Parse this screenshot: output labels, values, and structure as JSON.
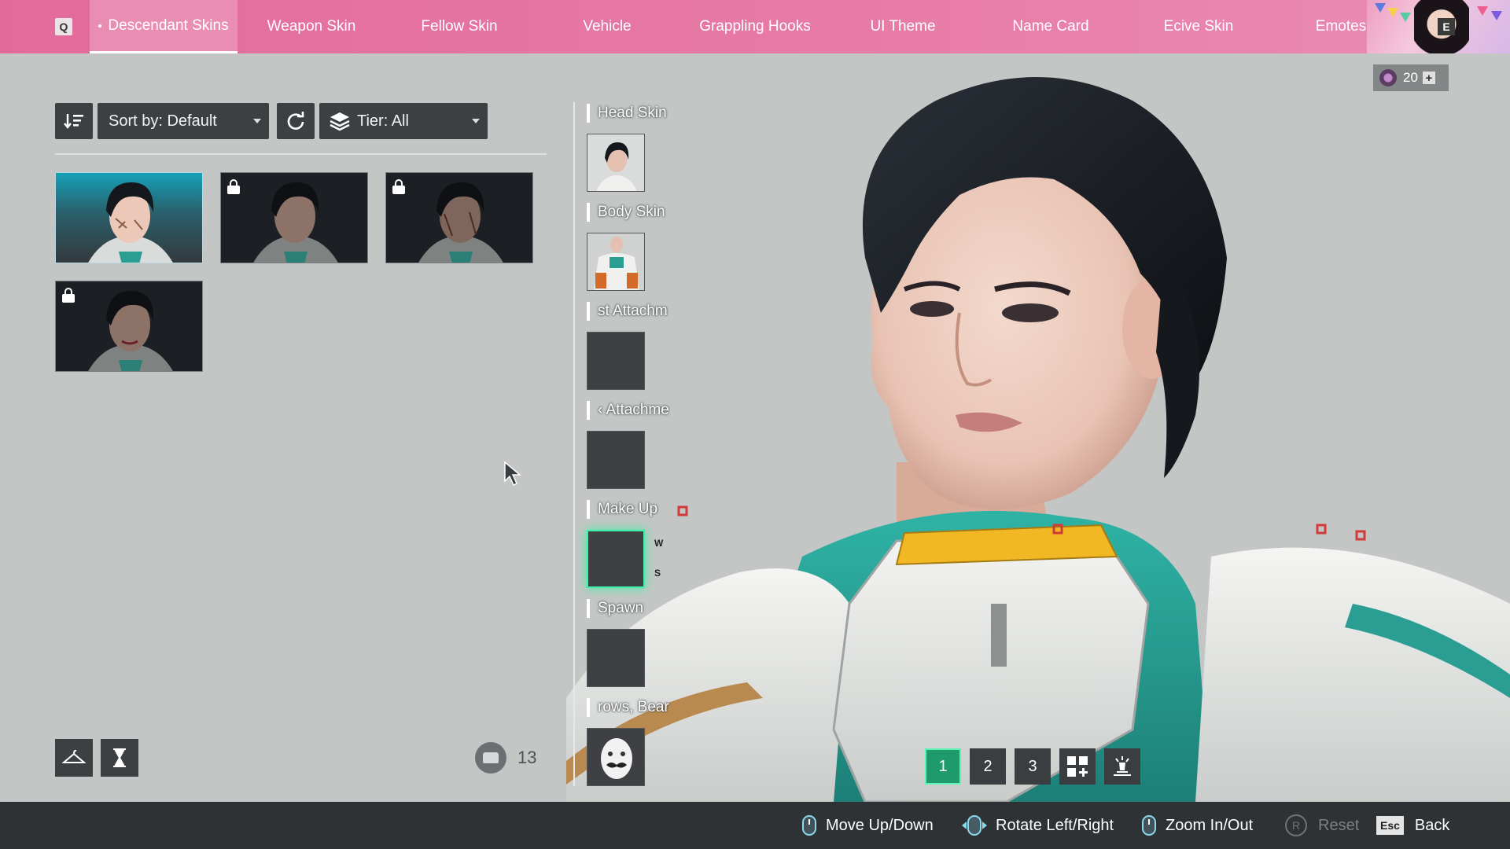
{
  "nav": {
    "prev_key": "Q",
    "next_key": "E",
    "tabs": [
      {
        "label": "Descendant Skins",
        "active": true
      },
      {
        "label": "Weapon Skin"
      },
      {
        "label": "Fellow Skin"
      },
      {
        "label": "Vehicle"
      },
      {
        "label": "Grappling Hooks"
      },
      {
        "label": "UI Theme"
      },
      {
        "label": "Name Card"
      },
      {
        "label": "Ecive Skin"
      },
      {
        "label": "Emotes"
      }
    ]
  },
  "currency": {
    "amount": "20",
    "plus": "+"
  },
  "filters": {
    "sort_label": "Sort by: Default",
    "tier_label": "Tier: All"
  },
  "skins": [
    {
      "locked": false,
      "selected": true
    },
    {
      "locked": true
    },
    {
      "locked": true
    },
    {
      "locked": true
    }
  ],
  "inventory": {
    "count": "13"
  },
  "slots": [
    {
      "label": "Head Skin"
    },
    {
      "label": "Body Skin"
    },
    {
      "label": "st Attachm"
    },
    {
      "label": "‹ Attachme"
    },
    {
      "label": "Make Up",
      "selected": true
    },
    {
      "label": "Spawn"
    },
    {
      "label": "rows, Bear"
    }
  ],
  "slot_keys": {
    "up": "W",
    "down": "S"
  },
  "presets": [
    "1",
    "2",
    "3"
  ],
  "hints": [
    {
      "label": "Move Up/Down"
    },
    {
      "label": "Rotate Left/Right"
    },
    {
      "label": "Zoom In/Out"
    },
    {
      "key": "R",
      "label": "Reset"
    },
    {
      "key": "Esc",
      "label": "Back"
    }
  ],
  "colors": {
    "nav_pink": "#e36b9c",
    "accent_green": "#3cf0a6",
    "suit_teal": "#2a9e93",
    "armor_white": "#eef0ee",
    "armor_yellow": "#f2b824"
  }
}
